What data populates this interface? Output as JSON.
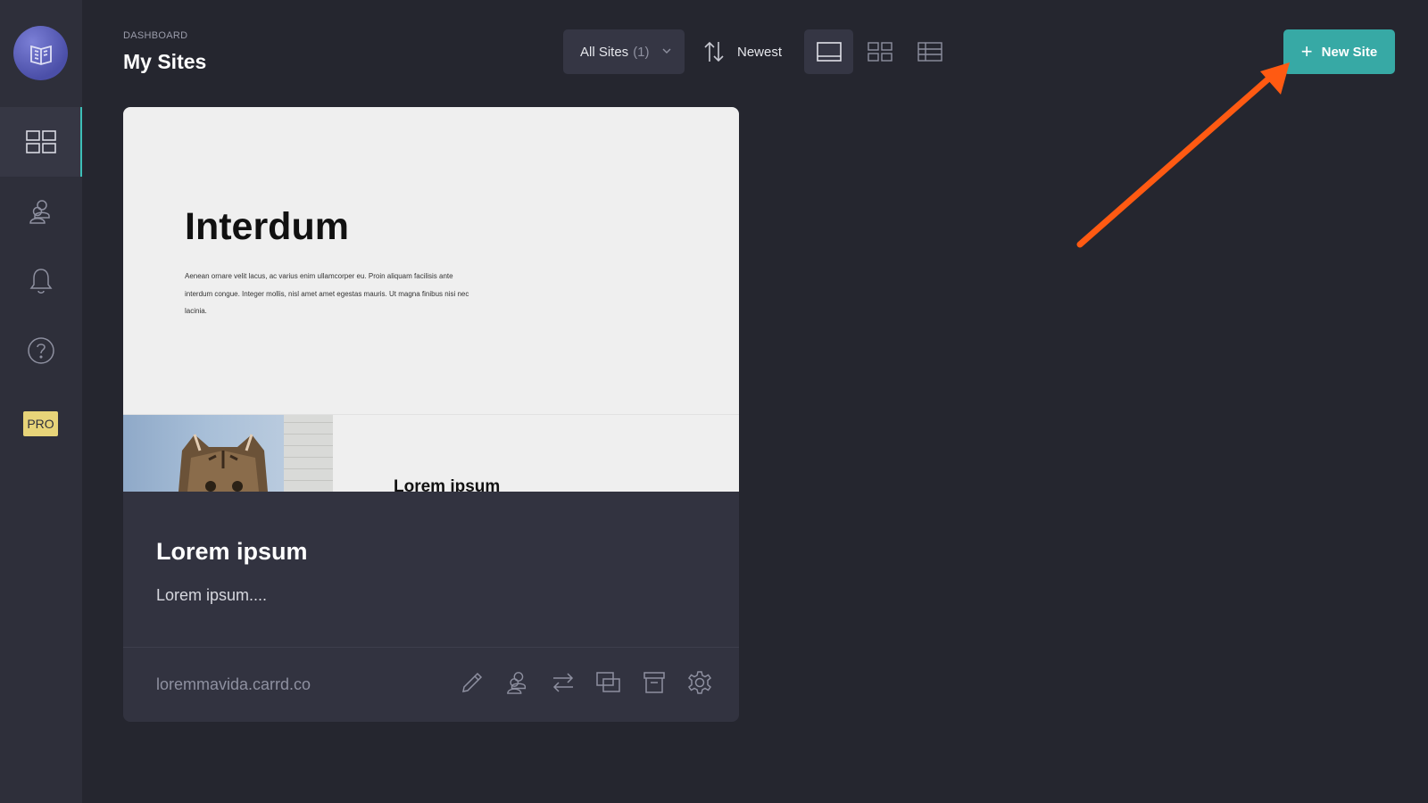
{
  "header": {
    "breadcrumb": "DASHBOARD",
    "title": "My Sites"
  },
  "toolbar": {
    "filter_label": "All Sites",
    "filter_count": "(1)",
    "sort_label": "Newest",
    "new_site_label": "New Site"
  },
  "sidebar": {
    "items": [
      {
        "icon": "grid-icon",
        "active": true
      },
      {
        "icon": "users-icon",
        "active": false
      },
      {
        "icon": "bell-icon",
        "active": false
      },
      {
        "icon": "help-icon",
        "active": false
      }
    ],
    "pro_label": "PRO"
  },
  "site": {
    "preview": {
      "heading": "Interdum",
      "body": "Aenean ornare velit lacus, ac varius enim ullamcorper eu. Proin aliquam facilisis ante interdum congue. Integer mollis, nisl amet amet egestas mauris. Ut magna finibus nisi nec lacinia.",
      "subheading": "Lorem ipsum"
    },
    "title": "Lorem ipsum",
    "description": "Lorem ipsum....",
    "url": "loremmavida.carrd.co",
    "actions": [
      "edit-icon",
      "collaborators-icon",
      "transfer-icon",
      "duplicate-icon",
      "archive-icon",
      "settings-icon"
    ]
  },
  "colors": {
    "background": "#25262f",
    "sidebar": "#2e2f3a",
    "accent": "#37a9a5",
    "pro_badge": "#e7d479",
    "annotation_arrow": "#ff5a12"
  }
}
